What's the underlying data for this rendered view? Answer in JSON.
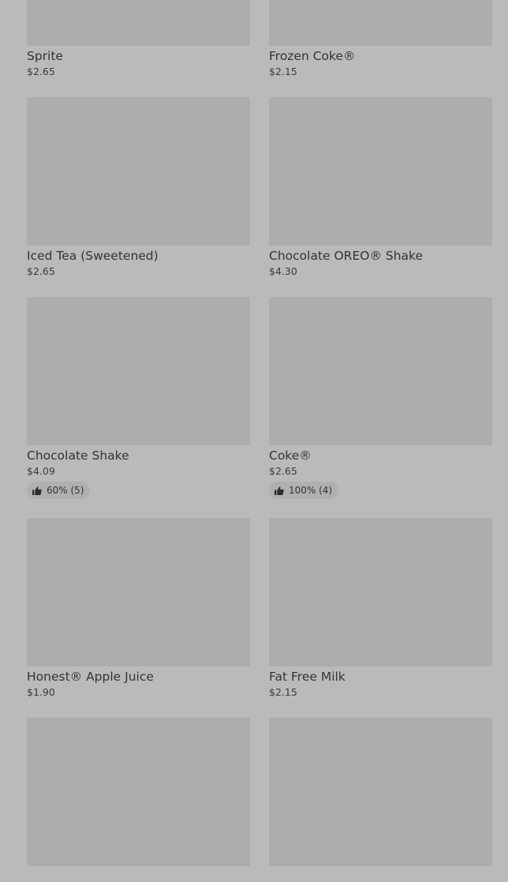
{
  "menu": {
    "items": [
      {
        "name": "Sprite",
        "price": "$2.65"
      },
      {
        "name": "Frozen Coke®",
        "price": "$2.15"
      },
      {
        "name": "Iced Tea (Sweetened)",
        "price": "$2.65"
      },
      {
        "name": "Chocolate OREO® Shake",
        "price": "$4.30"
      },
      {
        "name": "Chocolate Shake",
        "price": "$4.09",
        "rating": "60% (5)"
      },
      {
        "name": "Coke®",
        "price": "$2.65",
        "rating": "100% (4)"
      },
      {
        "name": "Honest® Apple Juice",
        "price": "$1.90"
      },
      {
        "name": "Fat Free Milk",
        "price": "$2.15"
      },
      {
        "name": "",
        "price": ""
      },
      {
        "name": "",
        "price": ""
      }
    ]
  },
  "icons": {
    "rating": "thumbs-up-icon"
  }
}
